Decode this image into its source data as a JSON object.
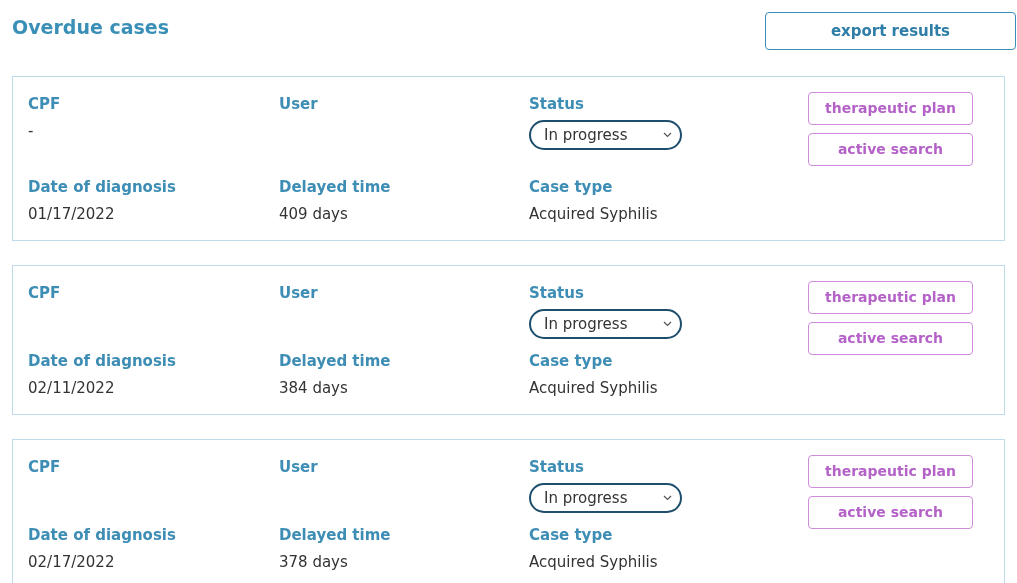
{
  "title": "Overdue cases",
  "export_button": "export results",
  "cases": [
    {
      "cpf_label": "CPF",
      "cpf_value": "-",
      "user_label": "User",
      "status_label": "Status",
      "status_value": "In progress",
      "date_label": "Date of diagnosis",
      "date_value": "01/17/2022",
      "delay_label": "Delayed time",
      "delay_value": "409 days",
      "type_label": "Case type",
      "type_value": "Acquired Syphilis",
      "actions": [
        "therapeutic plan",
        "active search"
      ]
    },
    {
      "cpf_label": "CPF",
      "user_label": "User",
      "status_label": "Status",
      "status_value": "In progress",
      "date_label": "Date of diagnosis",
      "date_value": "02/11/2022",
      "delay_label": "Delayed time",
      "delay_value": "384 days",
      "type_label": "Case type",
      "type_value": "Acquired Syphilis",
      "actions": [
        "therapeutic plan",
        "active search"
      ]
    },
    {
      "cpf_label": "CPF",
      "user_label": "User",
      "status_label": "Status",
      "status_value": "In progress",
      "date_label": "Date of diagnosis",
      "date_value": "02/17/2022",
      "delay_label": "Delayed time",
      "delay_value": "378 days",
      "type_label": "Case type",
      "type_value": "Acquired Syphilis",
      "actions": [
        "therapeutic plan",
        "active search"
      ]
    }
  ]
}
